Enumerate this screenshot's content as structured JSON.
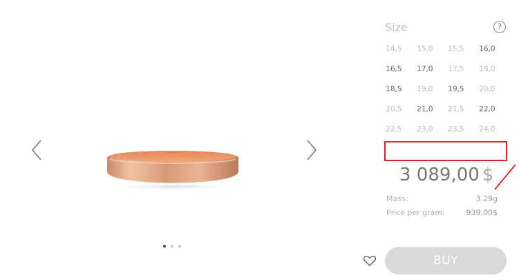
{
  "gallery": {
    "prev_icon": "chevron-left-icon",
    "next_icon": "chevron-right-icon",
    "ring_color": "#d9a17f",
    "slides": 3,
    "active_slide": 1
  },
  "size": {
    "title": "Size",
    "help_label": "?",
    "rows": [
      [
        {
          "v": "14,5",
          "a": false
        },
        {
          "v": "15,0",
          "a": false
        },
        {
          "v": "15,5",
          "a": false
        },
        {
          "v": "16,0",
          "a": true
        }
      ],
      [
        {
          "v": "16,5",
          "a": true
        },
        {
          "v": "17,0",
          "a": true
        },
        {
          "v": "17,5",
          "a": false
        },
        {
          "v": "18,0",
          "a": false
        }
      ],
      [
        {
          "v": "18,5",
          "a": true
        },
        {
          "v": "19,0",
          "a": false
        },
        {
          "v": "19,5",
          "a": true
        },
        {
          "v": "20,0",
          "a": false
        }
      ],
      [
        {
          "v": "20,5",
          "a": false
        },
        {
          "v": "21,0",
          "a": true
        },
        {
          "v": "21,5",
          "a": false
        },
        {
          "v": "22,0",
          "a": true
        }
      ],
      [
        {
          "v": "22,5",
          "a": false
        },
        {
          "v": "23,0",
          "a": false
        },
        {
          "v": "23,5",
          "a": false
        },
        {
          "v": "24,0",
          "a": false
        }
      ]
    ]
  },
  "price": {
    "value": "3 089,00",
    "currency": "$"
  },
  "details": {
    "mass_label": "Mass:",
    "mass_value": "3.29g",
    "ppg_label": "Price per gram:",
    "ppg_value": "939,00$"
  },
  "actions": {
    "favorite_icon": "heart-icon",
    "buy_label": "BUY"
  },
  "colors": {
    "highlight": "#e02020",
    "buy_bg": "#d9d9d9"
  }
}
